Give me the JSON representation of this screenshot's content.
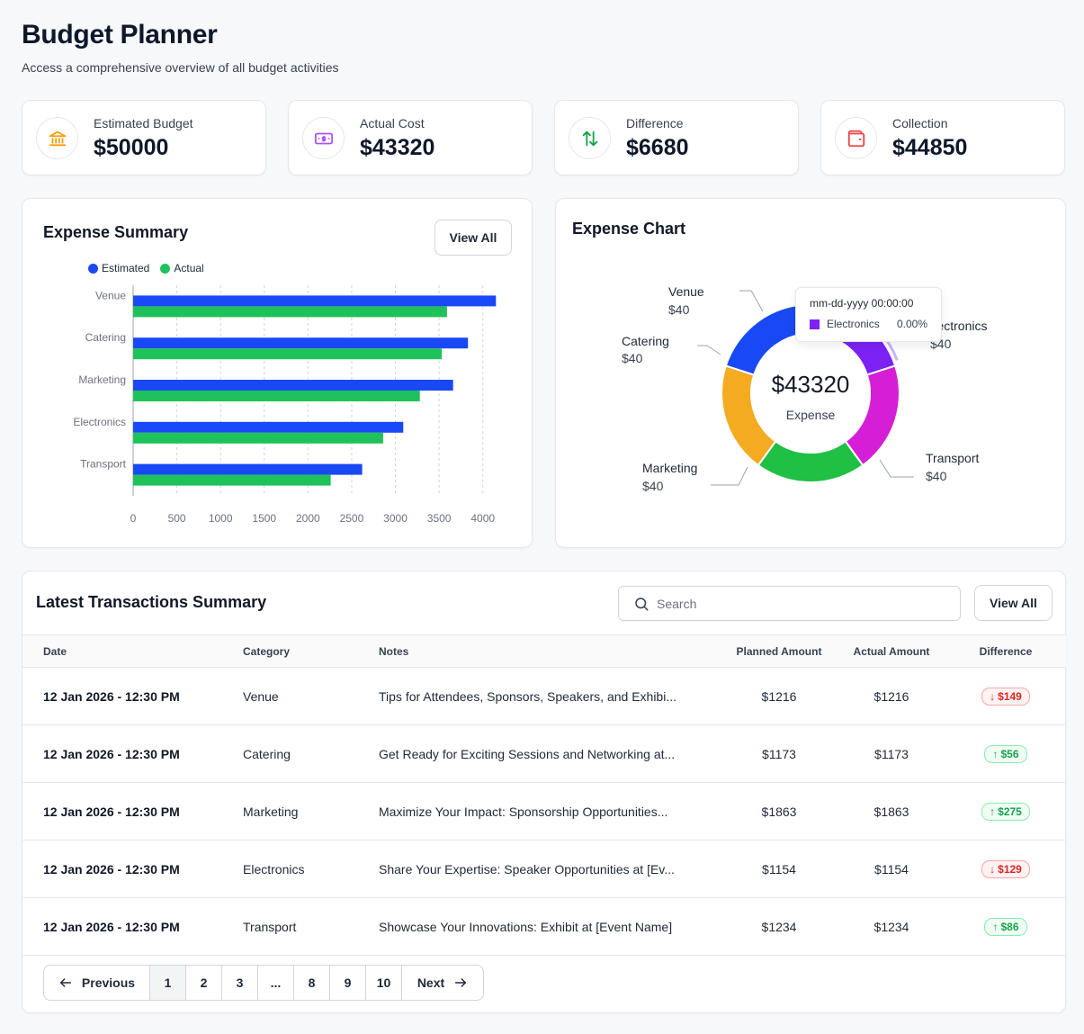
{
  "header": {
    "title": "Budget Planner",
    "subtitle": "Access a comprehensive overview of all budget activities"
  },
  "stats": [
    {
      "label": "Estimated Budget",
      "value": "$50000",
      "icon": "bank-icon",
      "color": "#f59e0b"
    },
    {
      "label": "Actual Cost",
      "value": "$43320",
      "icon": "cash-icon",
      "color": "#a855f7"
    },
    {
      "label": "Difference",
      "value": "$6680",
      "icon": "arrows-up-down-icon",
      "color": "#16a34a"
    },
    {
      "label": "Collection",
      "value": "$44850",
      "icon": "wallet-icon",
      "color": "#ef4444"
    }
  ],
  "expense_summary": {
    "title": "Expense Summary",
    "view_all": "View All",
    "legend": [
      "Estimated",
      "Actual"
    ]
  },
  "expense_chart": {
    "title": "Expense Chart",
    "center_value": "$43320",
    "center_label": "Expense",
    "labels": [
      {
        "name": "Venue",
        "value": "$40"
      },
      {
        "name": "Catering",
        "value": "$40"
      },
      {
        "name": "Marketing",
        "value": "$40"
      },
      {
        "name": "Transport",
        "value": "$40"
      },
      {
        "name": "Electronics",
        "value": "$40"
      }
    ],
    "tooltip": {
      "date": "mm-dd-yyyy 00:00:00",
      "series": "Electronics",
      "value": "0.00%"
    }
  },
  "chart_data": [
    {
      "type": "bar",
      "orientation": "horizontal",
      "categories": [
        "Venue",
        "Catering",
        "Marketing",
        "Electronics",
        "Transport"
      ],
      "series": [
        {
          "name": "Estimated",
          "values": [
            4150,
            3830,
            3660,
            3090,
            2620
          ],
          "color": "#1849f5"
        },
        {
          "name": "Actual",
          "values": [
            3590,
            3530,
            3280,
            2860,
            2260
          ],
          "color": "#1fc25a"
        }
      ],
      "xticks": [
        0,
        500,
        1000,
        1500,
        2000,
        2500,
        3000,
        3500,
        4000
      ],
      "xlim": [
        0,
        4250
      ],
      "grid": "vertical dashed",
      "legend": "top-left"
    },
    {
      "type": "pie",
      "donut": true,
      "categories": [
        "Electronics",
        "Transport",
        "Marketing",
        "Catering",
        "Venue"
      ],
      "values": [
        20,
        20,
        20,
        20,
        20
      ],
      "colors": [
        "#7c22f5",
        "#d41fd6",
        "#1fc044",
        "#f4ab22",
        "#1849f5"
      ]
    }
  ],
  "transactions": {
    "title": "Latest Transactions Summary",
    "search_placeholder": "Search",
    "view_all": "View All",
    "columns": [
      "Date",
      "Category",
      "Notes",
      "Planned Amount",
      "Actual Amount",
      "Difference"
    ],
    "rows": [
      {
        "date": "12 Jan 2026 - 12:30 PM",
        "category": "Venue",
        "notes": "Tips for Attendees, Sponsors, Speakers, and Exhibi...",
        "planned": "$1216",
        "actual": "$1216",
        "diff": "$149",
        "dir": "down"
      },
      {
        "date": "12 Jan 2026 - 12:30 PM",
        "category": "Catering",
        "notes": "Get Ready for Exciting Sessions and Networking at...",
        "planned": "$1173",
        "actual": "$1173",
        "diff": "$56",
        "dir": "up"
      },
      {
        "date": "12 Jan 2026 - 12:30 PM",
        "category": "Marketing",
        "notes": "Maximize Your Impact: Sponsorship Opportunities...",
        "planned": "$1863",
        "actual": "$1863",
        "diff": "$275",
        "dir": "up"
      },
      {
        "date": "12 Jan 2026 - 12:30 PM",
        "category": "Electronics",
        "notes": "Share Your Expertise: Speaker Opportunities at [Ev...",
        "planned": "$1154",
        "actual": "$1154",
        "diff": "$129",
        "dir": "down"
      },
      {
        "date": "12 Jan 2026 - 12:30 PM",
        "category": "Transport",
        "notes": "Showcase Your Innovations: Exhibit at [Event Name]",
        "planned": "$1234",
        "actual": "$1234",
        "diff": "$86",
        "dir": "up"
      }
    ],
    "pagination": {
      "previous": "Previous",
      "next": "Next",
      "pages": [
        "1",
        "2",
        "3",
        "...",
        "8",
        "9",
        "10"
      ],
      "current": "1"
    }
  }
}
